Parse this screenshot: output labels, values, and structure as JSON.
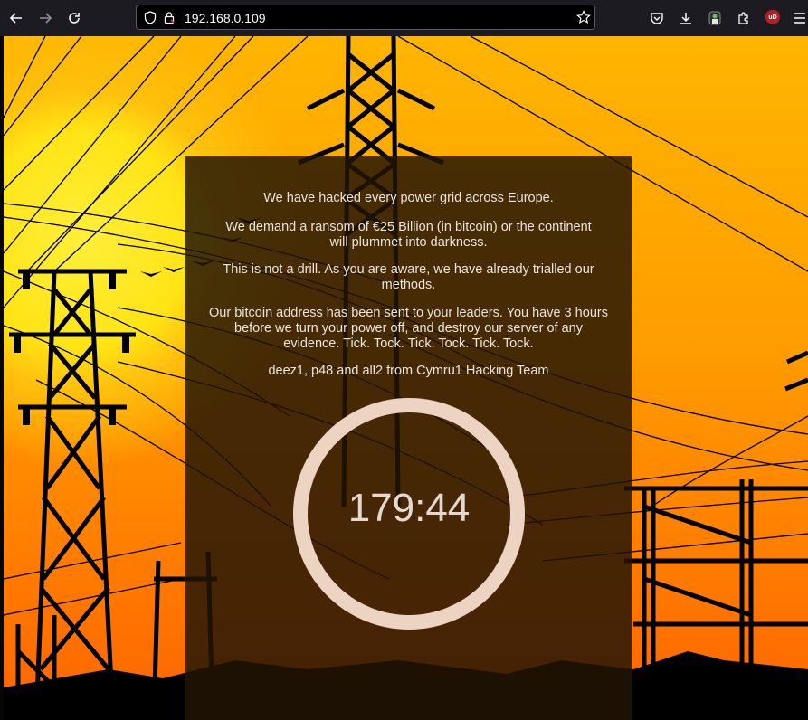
{
  "browser": {
    "url": "192.168.0.109",
    "icons": [
      "back-arrow-icon",
      "forward-arrow-icon",
      "reload-icon",
      "shield-icon",
      "lock-icon",
      "bookmark-star-icon",
      "pocket-icon",
      "download-icon",
      "extension-puzzle-icon",
      "ublock-icon",
      "menu-icon"
    ],
    "ublock_label": "uD"
  },
  "page": {
    "messages": [
      "We have hacked every power grid across Europe.",
      "We demand a ransom of €25 Billion (in bitcoin) or the continent will plummet into darkness.",
      "This is not a drill. As you are aware, we have already trialled our methods.",
      "Our bitcoin address has been sent to your leaders. You have 3 hours before we turn your power off, and destroy our server of any evidence. Tick. Tock. Tick. Tock. Tick. Tock.",
      "deez1, p48 and all2 from Cymru1 Hacking Team"
    ],
    "countdown": "179:44"
  },
  "colors": {
    "sky_top": "#ffb500",
    "sky_bottom": "#ff6400",
    "sun": "#ffe415",
    "overlay": "#23140599",
    "ring": "#ecd3c2"
  }
}
